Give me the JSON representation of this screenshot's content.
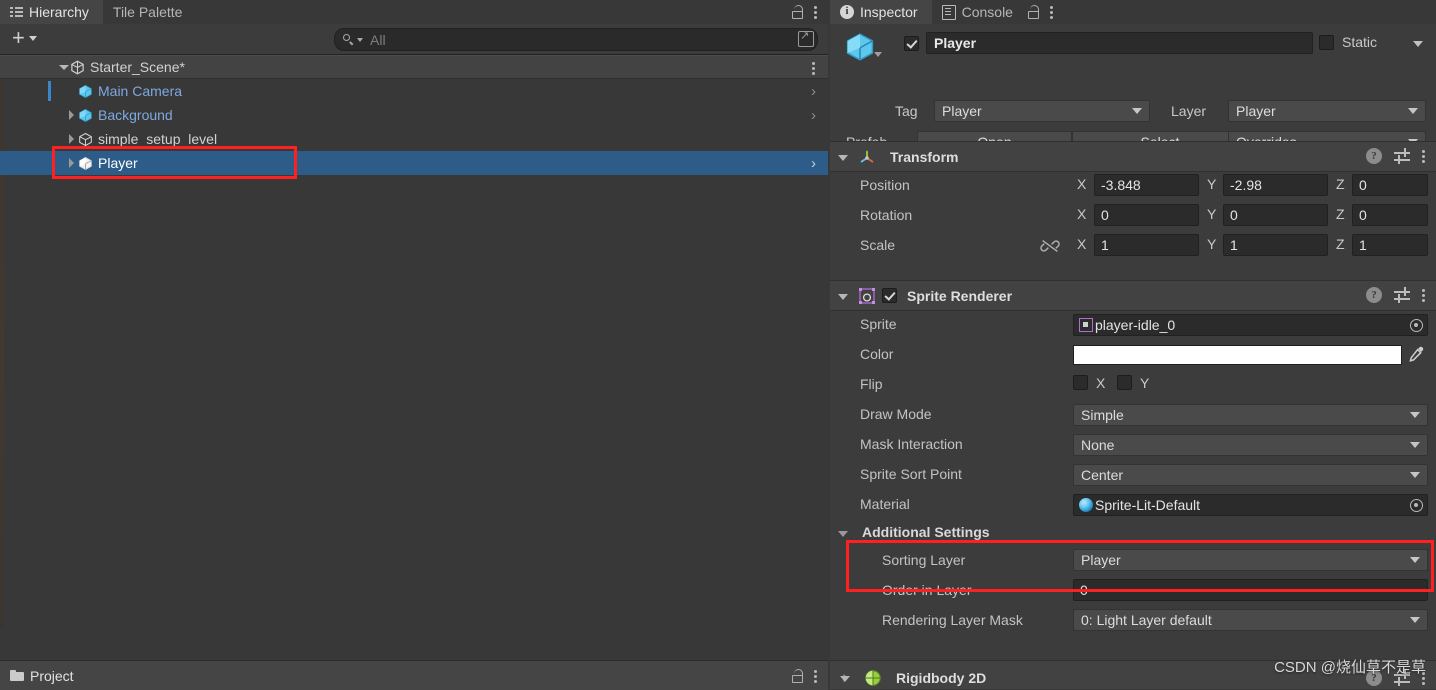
{
  "hierarchy": {
    "tabs": [
      {
        "label": "Hierarchy",
        "icon": "hierarchy-icon",
        "active": true
      },
      {
        "label": "Tile Palette",
        "icon": "",
        "active": false
      }
    ],
    "toolbar": {
      "add_label": "+",
      "search_placeholder": "All",
      "search_value": ""
    },
    "tree": [
      {
        "label": "Starter_Scene*",
        "indent": 0,
        "twisty": "open",
        "icon": "unity-scene-icon",
        "color": "white",
        "selected": false,
        "kebab": true,
        "chevron": false
      },
      {
        "label": "Main Camera",
        "indent": 1,
        "twisty": "none",
        "icon": "prefab-cube-icon",
        "color": "blue",
        "selected": false,
        "kebab": false,
        "chevron": true,
        "activebar": true
      },
      {
        "label": "Background",
        "indent": 1,
        "twisty": "closed",
        "icon": "prefab-cube-icon",
        "color": "blue",
        "selected": false,
        "kebab": false,
        "chevron": true
      },
      {
        "label": "simple_setup_level",
        "indent": 1,
        "twisty": "closed",
        "icon": "gameobject-cube-icon",
        "color": "white",
        "selected": false,
        "kebab": false,
        "chevron": false
      },
      {
        "label": "Player",
        "indent": 1,
        "twisty": "closed",
        "icon": "gameobject-cube-icon",
        "color": "sel",
        "selected": true,
        "kebab": false,
        "chevron": true
      }
    ]
  },
  "project_tab": {
    "label": "Project",
    "icon": "folder-icon"
  },
  "inspector": {
    "tabs": [
      {
        "label": "Inspector",
        "icon": "info-icon",
        "active": true
      },
      {
        "label": "Console",
        "icon": "console-icon",
        "active": false
      }
    ],
    "gameobject": {
      "enabled": true,
      "name": "Player",
      "static_label": "Static",
      "static_checked": false,
      "tag_label": "Tag",
      "tag_value": "Player",
      "layer_label": "Layer",
      "layer_value": "Player",
      "prefab_label": "Prefab",
      "prefab_open": "Open",
      "prefab_select": "Select",
      "prefab_overrides": "Overrides"
    },
    "components": [
      {
        "name": "Transform",
        "icon": "transform-axis-icon",
        "has_checkbox": false,
        "rows": [
          {
            "label": "Position",
            "x": "-3.848",
            "y": "-2.98",
            "z": "0"
          },
          {
            "label": "Rotation",
            "x": "0",
            "y": "0",
            "z": "0"
          },
          {
            "label": "Scale",
            "x": "1",
            "y": "1",
            "z": "1",
            "link_icon": "broken-link-icon"
          }
        ],
        "axis_labels": [
          "X",
          "Y",
          "Z"
        ]
      },
      {
        "name": "Sprite Renderer",
        "icon": "sprite-renderer-icon",
        "has_checkbox": true,
        "checked": true,
        "fields": [
          {
            "label": "Sprite",
            "type": "object",
            "value": "player-idle_0",
            "thumb": "sprite-thumb-icon"
          },
          {
            "label": "Color",
            "type": "color",
            "value": "#FFFFFF"
          },
          {
            "label": "Flip",
            "type": "flip",
            "x_label": "X",
            "y_label": "Y",
            "x_checked": false,
            "y_checked": false
          },
          {
            "label": "Draw Mode",
            "type": "dropdown",
            "value": "Simple"
          },
          {
            "label": "Mask Interaction",
            "type": "dropdown",
            "value": "None"
          },
          {
            "label": "Sprite Sort Point",
            "type": "dropdown",
            "value": "Center"
          },
          {
            "label": "Material",
            "type": "object",
            "value": "Sprite-Lit-Default",
            "thumb": "material-ball-icon"
          }
        ],
        "additional_settings": {
          "title": "Additional Settings",
          "fields": [
            {
              "label": "Sorting Layer",
              "type": "dropdown",
              "value": "Player",
              "highlighted": true
            },
            {
              "label": "Order in Layer",
              "type": "number",
              "value": "0"
            },
            {
              "label": "Rendering Layer Mask",
              "type": "dropdown",
              "value": "0: Light Layer default"
            }
          ]
        }
      },
      {
        "name": "Rigidbody 2D",
        "icon": "rigidbody2d-icon",
        "collapsed": true,
        "has_checkbox": false
      }
    ]
  },
  "watermark": "CSDN @烧仙草不是草",
  "colors": {
    "selection_blue": "#2c5c87",
    "link_blue": "#7ea9df",
    "highlight_red": "#ff2020",
    "panel_bg": "#3c3c3c",
    "hierarchy_bg": "#383838"
  }
}
